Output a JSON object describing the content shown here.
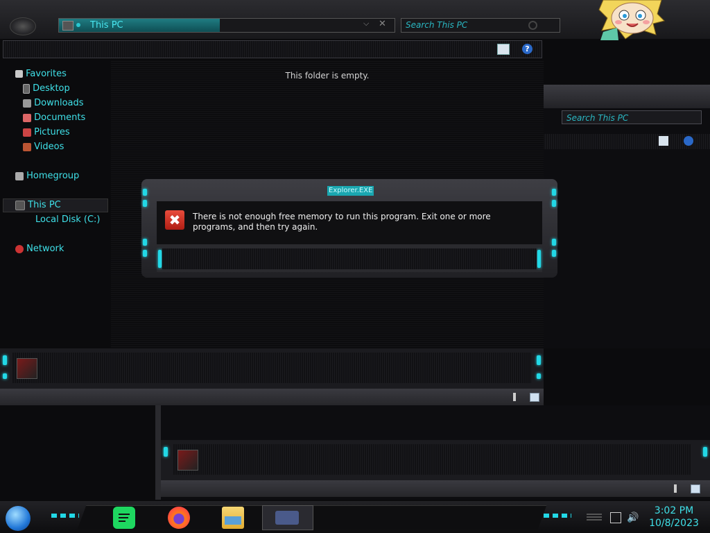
{
  "address_bar": {
    "location": "This PC"
  },
  "search": {
    "placeholder": "Search This PC"
  },
  "background_window": {
    "search_placeholder": "Search This PC"
  },
  "navigation": {
    "favorites": "Favorites",
    "favorite_items": [
      "Desktop",
      "Downloads",
      "Documents",
      "Pictures",
      "Videos"
    ],
    "homegroup": "Homegroup",
    "this_pc": "This PC",
    "drives": [
      "Local Disk (C:)"
    ],
    "network": "Network"
  },
  "content": {
    "empty_message": "This folder is empty."
  },
  "toolbar": {
    "help_label": "?"
  },
  "dialog": {
    "title": "Explorer.EXE",
    "icon": "error-icon",
    "icon_glyph": "✖",
    "message": "There is not enough free memory to run this program. Exit one or more programs, and then try again."
  },
  "taskbar": {
    "apps": [
      "spotify",
      "firefox",
      "file-explorer",
      "control-panel"
    ],
    "clock_time": "3:02 PM",
    "clock_date": "10/8/2023"
  },
  "colors": {
    "accent": "#3fe0e8",
    "error": "#d9332a"
  }
}
